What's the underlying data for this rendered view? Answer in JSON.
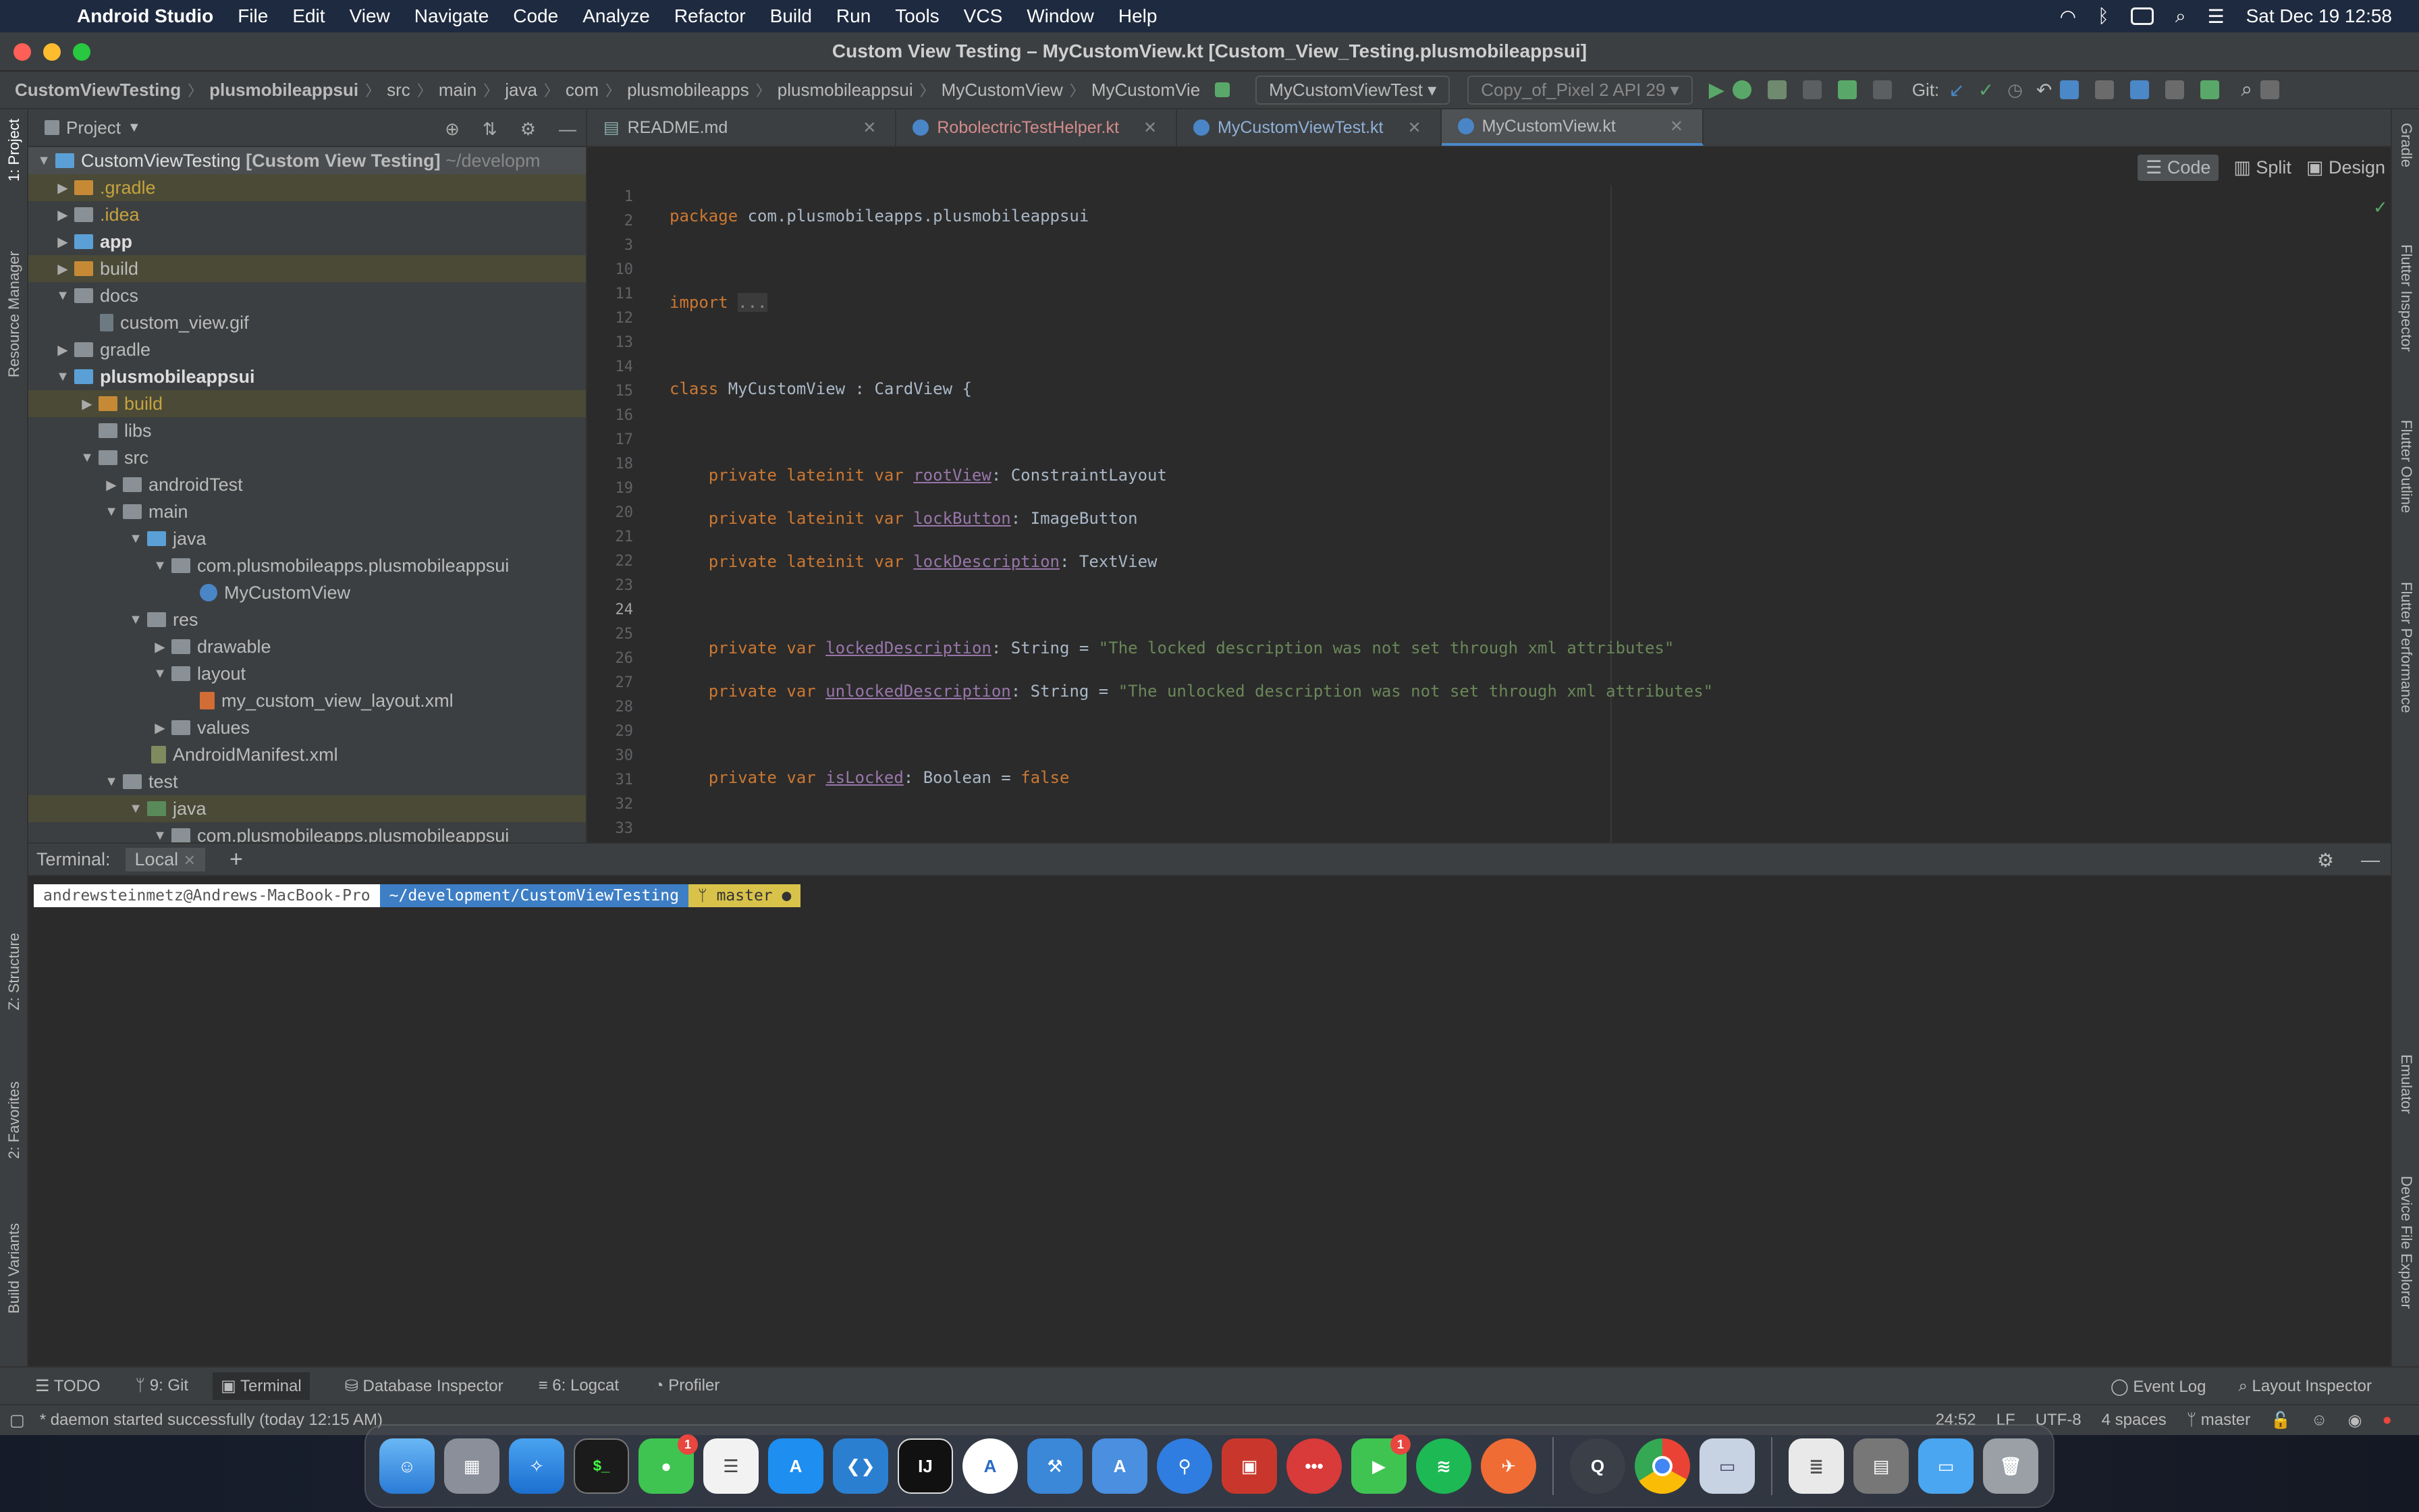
{
  "menubar": {
    "app_name": "Android Studio",
    "items": [
      "File",
      "Edit",
      "View",
      "Navigate",
      "Code",
      "Analyze",
      "Refactor",
      "Build",
      "Run",
      "Tools",
      "VCS",
      "Window",
      "Help"
    ],
    "clock": "Sat Dec 19  12:58"
  },
  "window": {
    "title": "Custom View Testing – MyCustomView.kt [Custom_View_Testing.plusmobileappsui]"
  },
  "navbar": {
    "crumbs": [
      "CustomViewTesting",
      "plusmobileappsui",
      "src",
      "main",
      "java",
      "com",
      "plusmobileapps",
      "plusmobileappsui",
      "MyCustomView",
      "MyCustomVie"
    ],
    "run_config": "MyCustomViewTest",
    "device": "Copy_of_Pixel 2 API 29",
    "git_label": "Git:"
  },
  "left_stripe": {
    "project": "1: Project",
    "resource_manager": "Resource Manager",
    "structure": "Z: Structure",
    "favorites": "2: Favorites",
    "build_variants": "Build Variants"
  },
  "right_stripe": {
    "gradle": "Gradle",
    "flutter_inspector": "Flutter Inspector",
    "flutter_outline": "Flutter Outline",
    "flutter_performance": "Flutter Performance",
    "emulator": "Emulator",
    "device_file_explorer": "Device File Explorer"
  },
  "project": {
    "title": "Project",
    "root_name": "CustomViewTesting",
    "root_suffix": "[Custom View Testing]",
    "root_path": "~/developm",
    "rows": [
      {
        "label": ".gradle"
      },
      {
        "label": ".idea"
      },
      {
        "label": "app"
      },
      {
        "label": "build"
      },
      {
        "label": "docs"
      },
      {
        "label": "custom_view.gif"
      },
      {
        "label": "gradle"
      },
      {
        "label": "plusmobileappsui"
      },
      {
        "label": "build"
      },
      {
        "label": "libs"
      },
      {
        "label": "src"
      },
      {
        "label": "androidTest"
      },
      {
        "label": "main"
      },
      {
        "label": "java"
      },
      {
        "label": "com.plusmobileapps.plusmobileappsui"
      },
      {
        "label": "MyCustomView"
      },
      {
        "label": "res"
      },
      {
        "label": "drawable"
      },
      {
        "label": "layout"
      },
      {
        "label": "my_custom_view_layout.xml"
      },
      {
        "label": "values"
      },
      {
        "label": "AndroidManifest.xml"
      },
      {
        "label": "test"
      },
      {
        "label": "java"
      },
      {
        "label": "com.plusmobileapps.plusmobileappsui"
      }
    ]
  },
  "editor": {
    "tabs": [
      "README.md",
      "RobolectricTestHelper.kt",
      "MyCustomViewTest.kt",
      "MyCustomView.kt"
    ],
    "modes": {
      "code": "Code",
      "split": "Split",
      "design": "Design"
    },
    "line_numbers": [
      "1",
      "2",
      "3",
      "10",
      "11",
      "12",
      "13",
      "14",
      "15",
      "16",
      "17",
      "18",
      "19",
      "20",
      "21",
      "22",
      "23",
      "24",
      "25",
      "26",
      "27",
      "28",
      "29",
      "30",
      "31",
      "32",
      "33"
    ]
  },
  "terminal": {
    "label": "Terminal:",
    "tab": "Local",
    "prompt_user": "andrewsteinmetz@Andrews-MacBook-Pro",
    "prompt_path": "~/development/CustomViewTesting",
    "prompt_branch": "ᛘ master ●"
  },
  "toolwindows": {
    "todo": "TODO",
    "git": "9: Git",
    "terminal": "Terminal",
    "database": "Database Inspector",
    "logcat": "6: Logcat",
    "profiler": "Profiler",
    "event_log": "Event Log",
    "layout_inspector": "Layout Inspector"
  },
  "status": {
    "message": "* daemon started successfully (today 12:15 AM)",
    "position": "24:52",
    "line_sep": "LF",
    "encoding": "UTF-8",
    "indent": "4 spaces",
    "branch": "master"
  },
  "dock": {
    "apps": [
      "Finder",
      "Launchpad",
      "Safari",
      "Terminal",
      "Messages",
      "Reminders",
      "App Store",
      "VS Code",
      "IntelliJ IDEA",
      "Pythonista",
      "Xcode",
      "Instruments",
      "Maps",
      "Simulator",
      "Reeder",
      "Facetime",
      "Spotify",
      "Postman",
      "QuickTime",
      "Chrome",
      "Preview",
      "Notes",
      "Files",
      "Downloads",
      "Trash"
    ],
    "badge_messages": "1",
    "badge_facetime": "1"
  },
  "colors": {
    "accent": "#4a88c7",
    "keyword": "#cc7832",
    "string": "#6a8759",
    "function": "#ffc66d",
    "property": "#9876aa"
  }
}
